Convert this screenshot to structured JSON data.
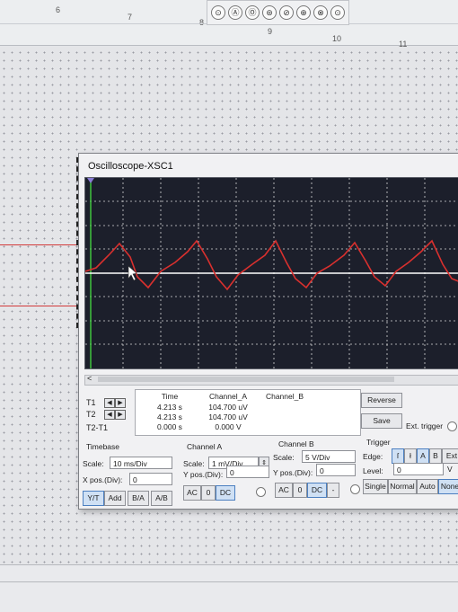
{
  "ruler": {
    "numbers": [
      "6",
      "7",
      "8",
      "9",
      "10",
      "11"
    ]
  },
  "window": {
    "title": "Oscilloscope-XSC1",
    "close_label": "×"
  },
  "readouts": {
    "rows": [
      "T1",
      "T2",
      "T2-T1"
    ],
    "headers": {
      "time": "Time",
      "channel_a": "Channel_A",
      "channel_b": "Channel_B"
    },
    "time": [
      "4.213 s",
      "4.213 s",
      "0.000 s"
    ],
    "channel_a": [
      "104.700 uV",
      "104.700 uV",
      "0.000 V"
    ]
  },
  "side": {
    "reverse": "Reverse",
    "save": "Save",
    "ext_trigger": "Ext. trigger"
  },
  "timebase": {
    "title": "Timebase",
    "scale_label": "Scale:",
    "scale_value": "10 ms/Div",
    "xpos_label": "X pos.(Div):",
    "xpos_value": "0",
    "modes": [
      "Y/T",
      "Add",
      "B/A",
      "A/B"
    ]
  },
  "channel_a": {
    "title": "Channel A",
    "scale_label": "Scale:",
    "scale_value": "1 mV/Div",
    "ypos_label": "Y pos.(Div):",
    "ypos_value": "0",
    "coupling": [
      "AC",
      "0",
      "DC"
    ]
  },
  "channel_b": {
    "title": "Channel B",
    "scale_label": "Scale:",
    "scale_value": "5 V/Div",
    "ypos_label": "Y pos.(Div):",
    "ypos_value": "0",
    "coupling": [
      "AC",
      "0",
      "DC",
      "-"
    ]
  },
  "trigger": {
    "title": "Trigger",
    "edge_label": "Edge:",
    "level_label": "Level:",
    "level_value": "0",
    "level_unit": "V",
    "modes": [
      "Single",
      "Normal",
      "Auto",
      "None"
    ],
    "sources": [
      "A",
      "B",
      "Ext"
    ]
  },
  "colors": {
    "screen_bg": "#1c1f2b",
    "trace_a": "#d9302e",
    "trace_b": "#ffffff",
    "wire": "#d23a3a"
  },
  "icons": [
    "toolbar-circle-icon",
    "cursor-icon",
    "scroll-arrow-icon",
    "up-down-arrow-icon"
  ]
}
